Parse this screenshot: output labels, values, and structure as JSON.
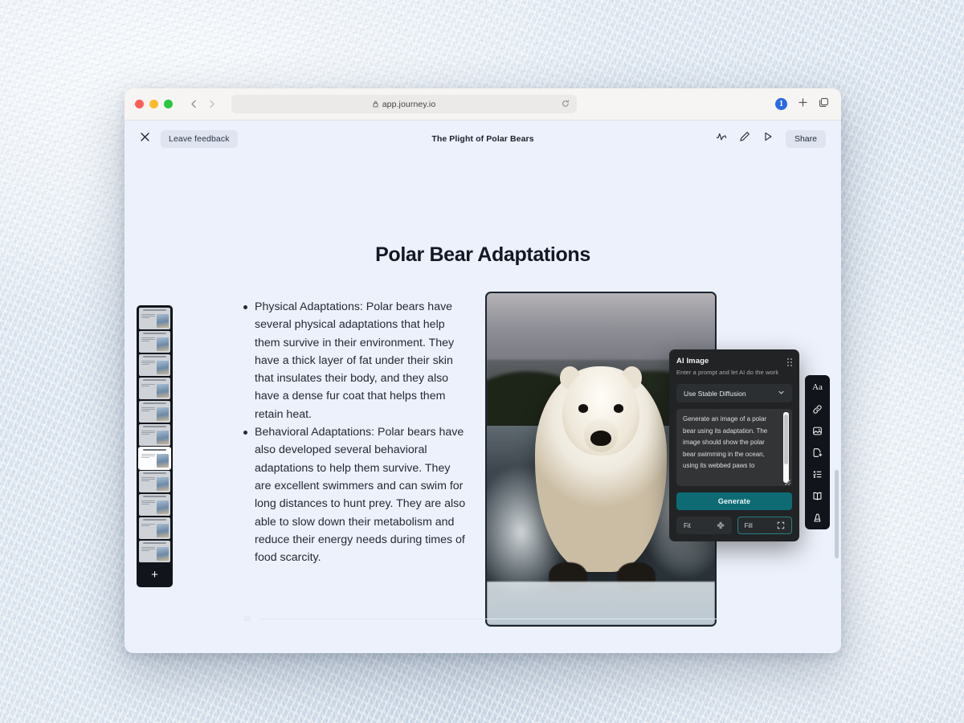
{
  "browser": {
    "url": "app.journey.io",
    "lock_icon": "lock-icon",
    "reload_icon": "reload-icon",
    "back_icon": "chevron-left-icon",
    "forward_icon": "chevron-right-icon",
    "extension_badge": "1",
    "new_tab_icon": "plus-icon",
    "tabs_icon": "copy-tabs-icon"
  },
  "app_bar": {
    "close_icon": "close-icon",
    "feedback_label": "Leave feedback",
    "doc_title": "The Plight of Polar Bears",
    "analytics_icon": "analytics-pulse-icon",
    "edit_icon": "pencil-icon",
    "present_icon": "play-icon",
    "share_label": "Share"
  },
  "slide": {
    "title": "Polar Bear Adaptations",
    "bullets": [
      "Physical Adaptations: Polar bears have several physical adaptations that help them survive in their environment. They have a thick layer of fat under their skin that insulates their body, and they also have a dense fur coat that helps them retain heat.",
      "Behavioral Adaptations: Polar bears have also developed several behavioral adaptations to help them survive. They are excellent swimmers and can swim for long distances to hunt prey. They are also able to slow down their metabolism and reduce their energy needs during times of food scarcity."
    ],
    "page_number": "10",
    "image_alt": "polar-bear-swimming-photo"
  },
  "thumbnails": {
    "count": 11,
    "selected_index": 7,
    "add_label": "+"
  },
  "ai_panel": {
    "title": "AI Image",
    "subtitle": "Enter a prompt and let AI do the work",
    "grip_icon": "drag-handle-icon",
    "model_select": "Use Stable Diffusion",
    "chevron_icon": "chevron-down-icon",
    "prompt": "Generate an image of a polar bear using its adaptation. The image should show the polar bear swimming in the ocean, using its webbed paws to",
    "generate_label": "Generate",
    "fit_label": "Fit",
    "fill_label": "Fill",
    "fit_icon": "collapse-arrows-icon",
    "fill_icon": "expand-corners-icon",
    "active_mode": "Fill",
    "accent_color": "#0e6b74",
    "active_border_color": "#2b7f86"
  },
  "side_toolbar": {
    "items": [
      {
        "name": "text-icon",
        "glyph": "Aa"
      },
      {
        "name": "link-icon",
        "glyph": ""
      },
      {
        "name": "image-icon",
        "glyph": ""
      },
      {
        "name": "file-add-icon",
        "glyph": ""
      },
      {
        "name": "list-icon",
        "glyph": ""
      },
      {
        "name": "book-icon",
        "glyph": ""
      },
      {
        "name": "shape-icon",
        "glyph": ""
      }
    ]
  }
}
